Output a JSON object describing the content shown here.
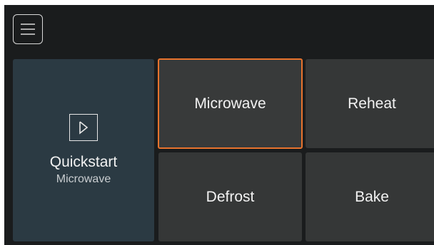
{
  "header": {
    "menu_icon": "hamburger-menu-icon"
  },
  "quickstart": {
    "icon": "play-icon",
    "title": "Quickstart",
    "subtitle": "Microwave"
  },
  "modes": [
    {
      "label": "Microwave",
      "selected": true
    },
    {
      "label": "Reheat",
      "selected": false
    },
    {
      "label": "Defrost",
      "selected": false
    },
    {
      "label": "Bake",
      "selected": false
    }
  ],
  "colors": {
    "background": "#1a1c1d",
    "quickstart_tile": "#2b3a43",
    "tile": "#353737",
    "selection_accent": "#e8732d",
    "text": "#f2f2f2"
  }
}
